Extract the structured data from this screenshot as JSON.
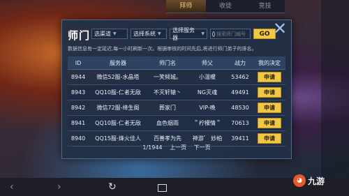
{
  "top_tabs": [
    "拜师",
    "收徒",
    "竞技"
  ],
  "title": "师门",
  "filters": {
    "channel": "选渠道",
    "system": "选择系统",
    "server": "选择服务器",
    "search_placeholder": "搜索师门编号",
    "go_label": "GO"
  },
  "notice": "数据信息有一定延迟,每一小时刷新一次。根据审核的时间先后,将进行师门弟子的排名。",
  "table": {
    "headers": [
      "ID",
      "服务器",
      "师门名",
      "师父",
      "战力",
      "我的决定"
    ],
    "rows": [
      {
        "id": "8944",
        "server": "微信52服-水晶塔",
        "name": "一笑倾城。",
        "master": "小温暖",
        "power": "53462",
        "action": "申请"
      },
      {
        "id": "8943",
        "server": "QQ10服-仁者无敌",
        "name": "不灭轩辕丶",
        "master": "NG灭魂",
        "power": "49491",
        "action": "申请"
      },
      {
        "id": "8942",
        "server": "微信72服-绛生阁",
        "name": "葬家门",
        "master": "VIP-晚",
        "power": "48530",
        "action": "申请"
      },
      {
        "id": "8941",
        "server": "QQ10服-仁者无敌",
        "name": "血色烟雨",
        "master": "＂柠檬情＂",
        "power": "70613",
        "action": "申请"
      },
      {
        "id": "8940",
        "server": "QQ15服-烽火佳人",
        "name": "百善孝为先",
        "master": "神游゛ 妙柏",
        "power": "39411",
        "action": "申请"
      }
    ]
  },
  "pager": {
    "page": "1/1944",
    "prev": "上一页",
    "next": "下一页"
  },
  "logo": "九游",
  "colors": {
    "accent": "#f2c744",
    "panel": "#22304 6"
  }
}
